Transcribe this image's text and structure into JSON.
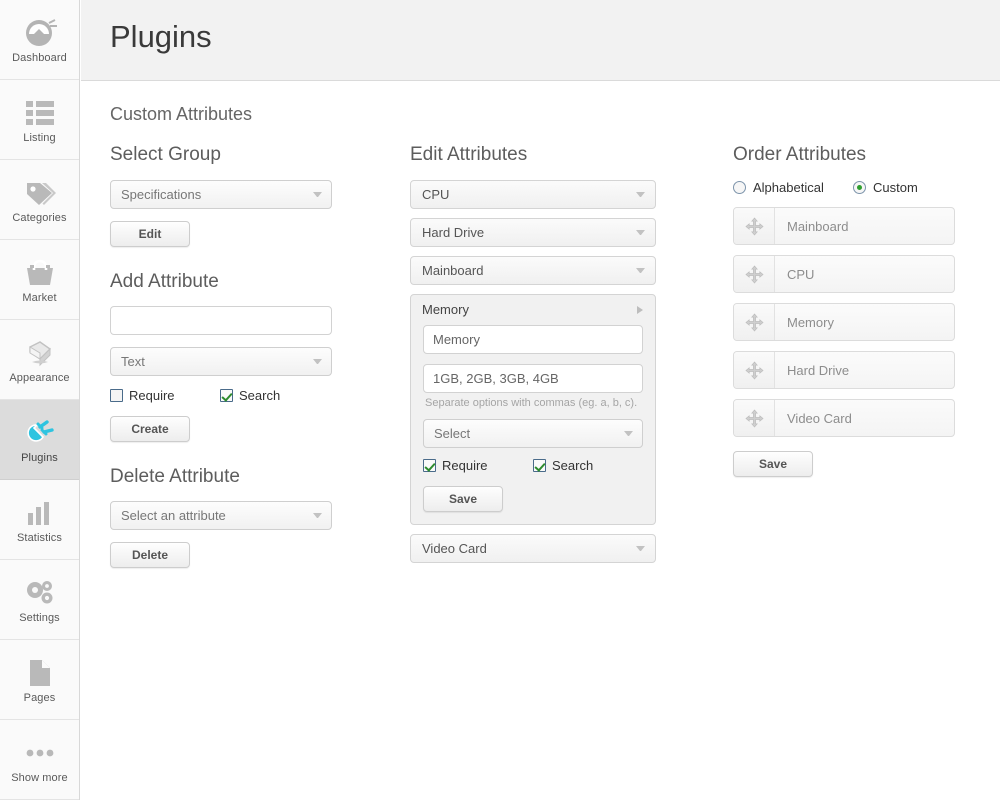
{
  "header": {
    "title": "Plugins"
  },
  "sidebar": {
    "items": [
      {
        "label": "Dashboard",
        "icon": "dashboard-icon",
        "active": false
      },
      {
        "label": "Listing",
        "icon": "listing-icon",
        "active": false
      },
      {
        "label": "Categories",
        "icon": "tag-icon",
        "active": false
      },
      {
        "label": "Market",
        "icon": "basket-icon",
        "active": false
      },
      {
        "label": "Appearance",
        "icon": "paint-bucket-icon",
        "active": false
      },
      {
        "label": "Plugins",
        "icon": "plug-icon",
        "active": true
      },
      {
        "label": "Statistics",
        "icon": "bar-chart-icon",
        "active": false
      },
      {
        "label": "Settings",
        "icon": "gears-icon",
        "active": false
      },
      {
        "label": "Pages",
        "icon": "page-icon",
        "active": false
      },
      {
        "label": "Show more",
        "icon": "ellipsis-icon",
        "active": false
      }
    ]
  },
  "main": {
    "section_title": "Custom Attributes",
    "select_group": {
      "heading": "Select Group",
      "dropdown_value": "Specifications",
      "edit_button": "Edit"
    },
    "add_attribute": {
      "heading": "Add Attribute",
      "name_value": "",
      "name_placeholder": "",
      "type_value": "Text",
      "require_label": "Require",
      "require_checked": false,
      "search_label": "Search",
      "search_checked": true,
      "create_button": "Create"
    },
    "delete_attribute": {
      "heading": "Delete Attribute",
      "dropdown_value": "Select an attribute",
      "delete_button": "Delete"
    },
    "edit_attributes": {
      "heading": "Edit Attributes",
      "collapsed_before": [
        "CPU",
        "Hard Drive",
        "Mainboard"
      ],
      "collapsed_after": [
        "Video Card"
      ],
      "expanded": {
        "title": "Memory",
        "name_value": "Memory",
        "options_value": "1GB, 2GB, 3GB, 4GB",
        "options_hint": "Separate options with commas (eg. a, b, c).",
        "type_value": "Select",
        "require_label": "Require",
        "require_checked": true,
        "search_label": "Search",
        "search_checked": true,
        "save_button": "Save"
      }
    },
    "order_attributes": {
      "heading": "Order Attributes",
      "mode_alphabetical_label": "Alphabetical",
      "mode_custom_label": "Custom",
      "selected_mode": "Custom",
      "items": [
        "Mainboard",
        "CPU",
        "Memory",
        "Hard Drive",
        "Video Card"
      ],
      "save_button": "Save"
    }
  },
  "colors": {
    "accent": "#28c0dd",
    "check": "#2e8b2e",
    "radio": "#2f9e2f",
    "header_bg": "#f2f2f2",
    "sidebar_bg": "#fafafa",
    "active_item_bg": "#dcdcdc"
  }
}
